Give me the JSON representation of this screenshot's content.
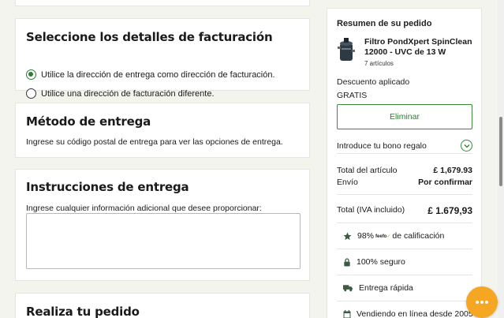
{
  "billing": {
    "title": "Seleccione los detalles de facturación",
    "option_same": "Utilice la dirección de entrega como dirección de facturación.",
    "option_different": "Utilice una dirección de facturación diferente."
  },
  "delivery_method": {
    "title": "Método de entrega",
    "text": "Ingrese su código postal de entrega para ver las opciones de entrega."
  },
  "instructions": {
    "title": "Instrucciones de entrega",
    "label": "Ingrese cualquier información adicional que desee proporcionar:",
    "value": ""
  },
  "place_order": {
    "title": "Realiza tu pedido"
  },
  "summary": {
    "title": "Resumen de su pedido",
    "product_name": "Filtro PondXpert SpinClean 12000 - UVC de 13 W",
    "product_count": "7 artículos",
    "discount_label": "Descuento aplicado",
    "discount_value": "GRATIS",
    "remove_label": "Eliminar",
    "voucher_label": "Introduce tu bono regalo",
    "item_total_label": "Total del artículo",
    "item_total_value": "£ 1,679.93",
    "shipping_label": "Envío",
    "shipping_value": "Por confirmar",
    "total_label": "Total (IVA incluido)",
    "total_value": "£ 1.679,93"
  },
  "badges": {
    "rating_value": "98%",
    "rating_brand": "feefo",
    "rating_suffix": "de calificación",
    "secure": "100% seguro",
    "fast_delivery": "Entrega rápida",
    "online_since": "Vendiendo en línea desde 2005"
  },
  "colors": {
    "accent_green": "#2e7d32",
    "chat_orange": "#f5a623",
    "page_bg": "#f4f4ef"
  },
  "icons": [
    "check-radio-icon",
    "star-icon",
    "lock-icon",
    "truck-icon",
    "calendar-icon",
    "chevron-down-icon",
    "chat-icon"
  ]
}
